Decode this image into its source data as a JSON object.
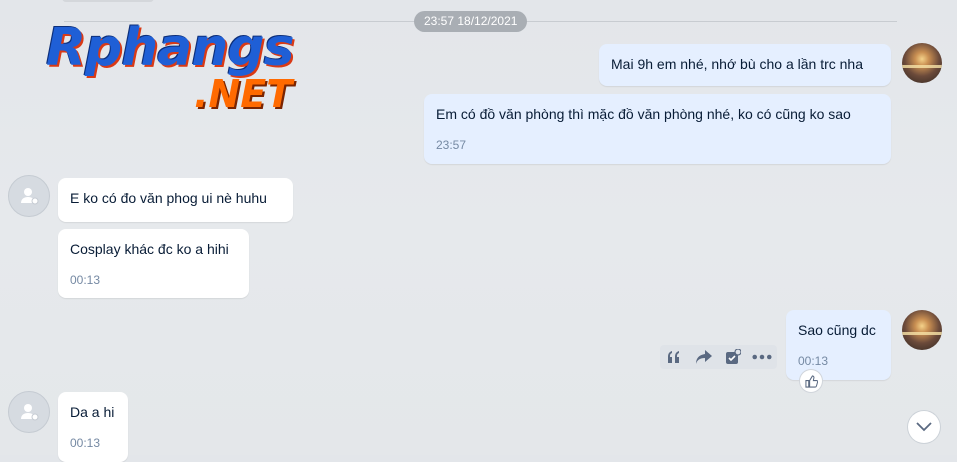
{
  "date_separator": "23:57 18/12/2021",
  "logo": {
    "line1": "Rphangs",
    "line2": ".NET"
  },
  "messages": [
    {
      "side": "me",
      "text": "Mai 9h em nhé, nhớ bù cho a lần trc nha",
      "time": ""
    },
    {
      "side": "me",
      "text": "Em có đồ văn phòng thì mặc đồ văn phòng nhé, ko có cũng ko sao",
      "time": "23:57"
    },
    {
      "side": "them",
      "text": "E ko có đo văn phog ui nè huhu",
      "time": ""
    },
    {
      "side": "them",
      "text": "Cosplay khác đc ko a hihi",
      "time": "00:13"
    },
    {
      "side": "me",
      "text": "Sao cũng dc",
      "time": "00:13"
    },
    {
      "side": "them",
      "text": "Da a hi",
      "time": "00:13"
    }
  ],
  "icons": {
    "quote": "quote-icon",
    "forward": "forward-icon",
    "add_todo": "task-icon",
    "more": "more-icon",
    "reaction": "thumbs-up-icon",
    "scroll": "chevron-down-icon"
  },
  "colors": {
    "my_bubble": "#e5efff",
    "their_bubble": "#ffffff",
    "date_chip": "#a9aeb4",
    "time_text": "#7589a3"
  }
}
